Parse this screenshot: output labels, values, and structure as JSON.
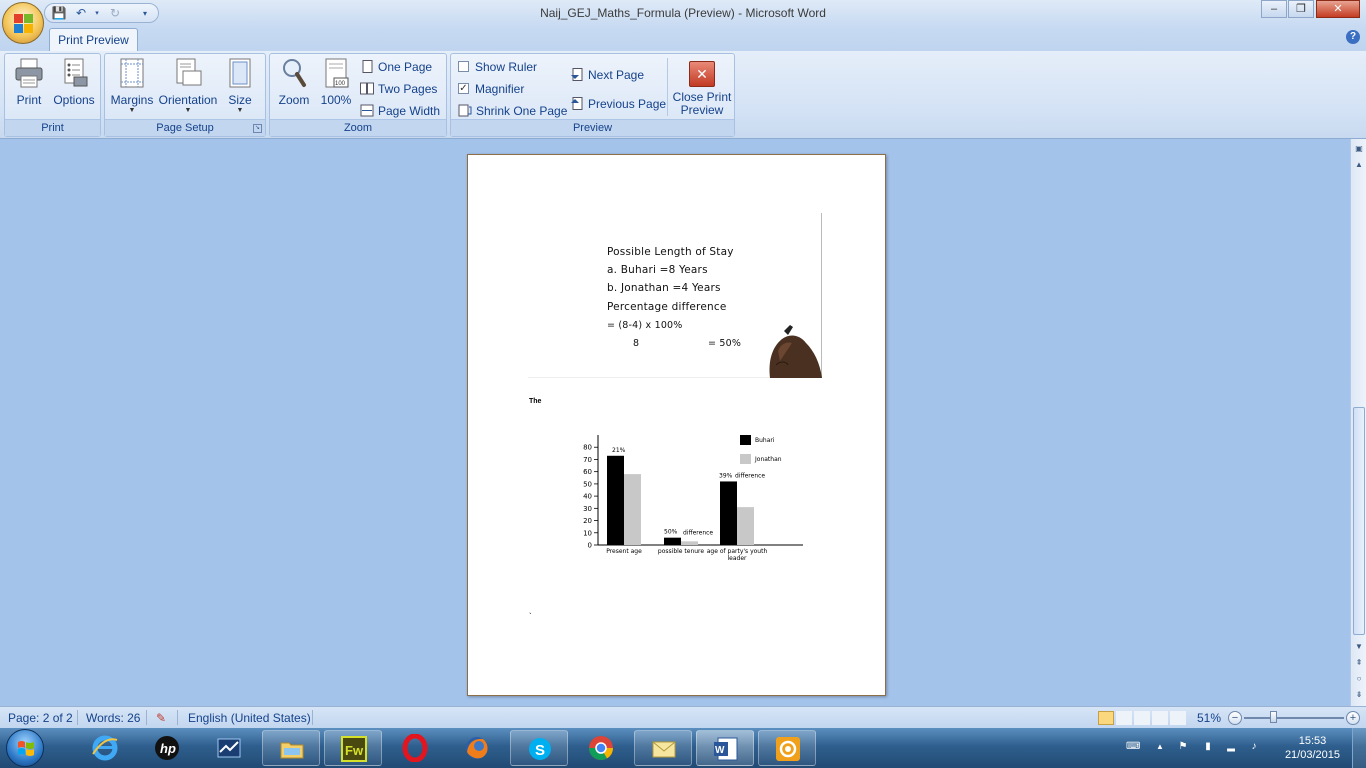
{
  "window": {
    "title": "Naij_GEJ_Maths_Formula (Preview) - Microsoft Word",
    "minimize_glyph": "–",
    "restore_glyph": "❐",
    "close_glyph": "✕"
  },
  "tabs": [
    {
      "label": "Print Preview",
      "active": true
    }
  ],
  "ribbon": {
    "print_group": {
      "label": "Print",
      "print": "Print",
      "options": "Options"
    },
    "page_setup_group": {
      "label": "Page Setup",
      "margins": "Margins",
      "orientation": "Orientation",
      "size": "Size"
    },
    "zoom_group": {
      "label": "Zoom",
      "zoom": "Zoom",
      "hundred": "100%",
      "one_page": "One Page",
      "two_pages": "Two Pages",
      "page_width": "Page Width"
    },
    "preview_group": {
      "label": "Preview",
      "show_ruler": "Show Ruler",
      "show_ruler_checked": false,
      "magnifier": "Magnifier",
      "magnifier_checked": true,
      "shrink_one_page": "Shrink One Page",
      "next_page": "Next Page",
      "previous_page": "Previous Page",
      "close_line1": "Close Print",
      "close_line2": "Preview"
    }
  },
  "document": {
    "image_lines": [
      "Possible Length of Stay",
      "a. Buhari        =8 Years",
      "b. Jonathan    =4 Years",
      "Percentage difference",
      "=  (8-4)  x 100%",
      "8",
      "=  50%"
    ],
    "caption": "The",
    "stray_mark": "`"
  },
  "chart_data": {
    "type": "bar",
    "categories": [
      "Present age",
      "possible tenure",
      "age of party's youth leader"
    ],
    "series": [
      {
        "name": "Buhari",
        "values": [
          73,
          6,
          52
        ],
        "color": "#000000"
      },
      {
        "name": "Jonathan",
        "values": [
          58,
          3,
          31
        ],
        "color": "#c8c8c8"
      }
    ],
    "annotations": [
      "21%",
      "50%",
      "difference",
      "39%",
      "difference"
    ],
    "y_ticks": [
      0,
      10,
      20,
      30,
      40,
      50,
      60,
      70,
      80
    ],
    "ylim": [
      0,
      90
    ],
    "legend_placement": "top-right",
    "grid": false
  },
  "statusbar": {
    "page": "Page: 2 of 2",
    "words": "Words: 26",
    "language": "English (United States)",
    "zoom_level": "51%",
    "zoom_fraction": 0.3
  },
  "taskbar": {
    "time": "15:53",
    "date": "21/03/2015",
    "apps": [
      "internet-explorer",
      "hp",
      "task-manager",
      "file-explorer",
      "fireworks",
      "opera",
      "firefox",
      "skype",
      "chrome",
      "outlook",
      "word",
      "presentation-app"
    ]
  },
  "colors": {
    "ribbon_text": "#15428b",
    "doc_background": "#a4c3eb",
    "close_red": "#c43c22"
  }
}
